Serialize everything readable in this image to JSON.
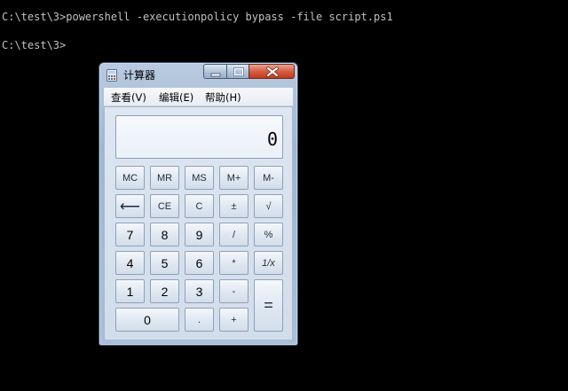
{
  "console": {
    "line1": "C:\\test\\3>powershell -executionpolicy bypass -file script.ps1",
    "line2": "C:\\test\\3>"
  },
  "calculator": {
    "title": "计算器",
    "menu": {
      "view": "查看(V)",
      "edit": "编辑(E)",
      "help": "帮助(H)"
    },
    "display_value": "0",
    "keys": {
      "mc": "MC",
      "mr": "MR",
      "ms": "MS",
      "mplus": "M+",
      "mminus": "M-",
      "backspace": "⟵",
      "ce": "CE",
      "c": "C",
      "plusminus": "±",
      "sqrt": "√",
      "d7": "7",
      "d8": "8",
      "d9": "9",
      "divide": "/",
      "percent": "%",
      "d4": "4",
      "d5": "5",
      "d6": "6",
      "multiply": "*",
      "reciprocal": "1/x",
      "d1": "1",
      "d2": "2",
      "d3": "3",
      "minus": "-",
      "equals": "=",
      "d0": "0",
      "decimal": ".",
      "plus": "+"
    }
  },
  "colors": {
    "console_bg": "#000000",
    "console_text": "#c0c0c0",
    "close_button": "#c94a2f"
  }
}
